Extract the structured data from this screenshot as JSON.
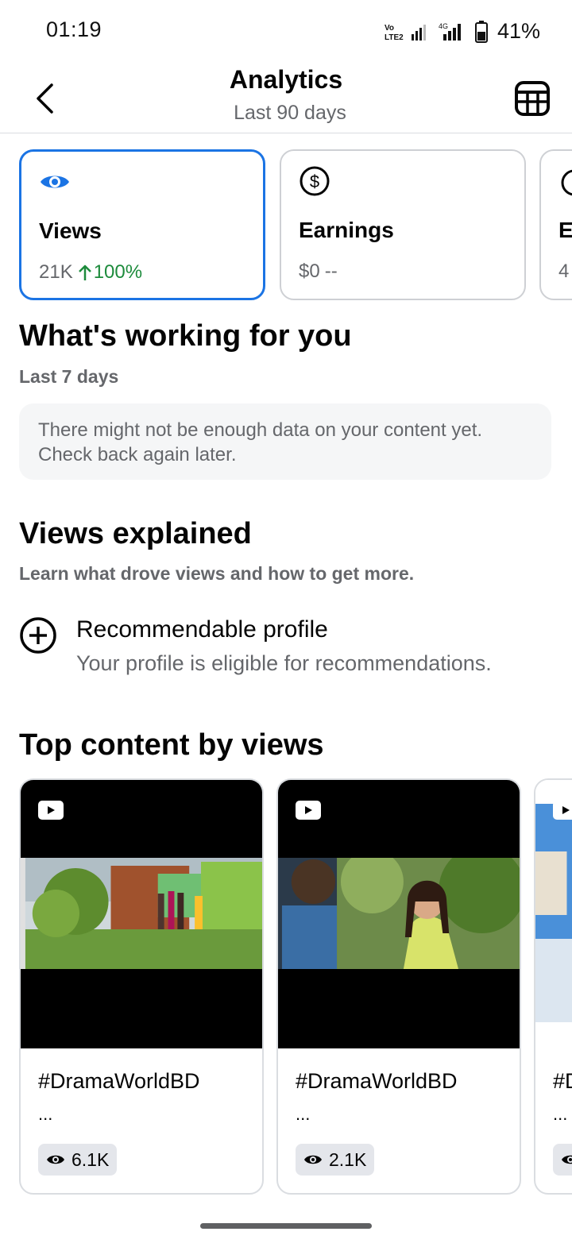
{
  "status_bar": {
    "time": "01:19",
    "volte_label": "Vo LTE2",
    "network_label": "4G",
    "battery_pct": "41%"
  },
  "header": {
    "title": "Analytics",
    "subtitle": "Last 90 days"
  },
  "metrics": [
    {
      "label": "Views",
      "value": "21K",
      "change": "100%",
      "icon": "eye-icon",
      "selected": true
    },
    {
      "label": "Earnings",
      "value": "$0",
      "change": "--",
      "icon": "dollar-circle-icon",
      "selected": false
    },
    {
      "label": "E",
      "value": "4",
      "icon": "partial-icon",
      "selected": false
    }
  ],
  "working": {
    "title": "What's working for you",
    "subtitle": "Last 7 days",
    "message": "There might not be enough data on your content yet. Check back again later."
  },
  "views_explained": {
    "title": "Views explained",
    "subtitle": "Learn what drove views and how to get more.",
    "item_title": "Recommendable profile",
    "item_desc": "Your profile is eligible for recommendations."
  },
  "top_content": {
    "title": "Top content by views",
    "cards": [
      {
        "title": "#DramaWorldBD",
        "ellipsis": "...",
        "views": "6.1K"
      },
      {
        "title": "#DramaWorldBD",
        "ellipsis": "...",
        "views": "2.1K"
      },
      {
        "title": "#D",
        "ellipsis": "...",
        "views": ""
      }
    ]
  },
  "colors": {
    "accent_blue": "#1b74e4",
    "positive_green": "#1d8b3c",
    "secondary_text": "#65676b"
  }
}
